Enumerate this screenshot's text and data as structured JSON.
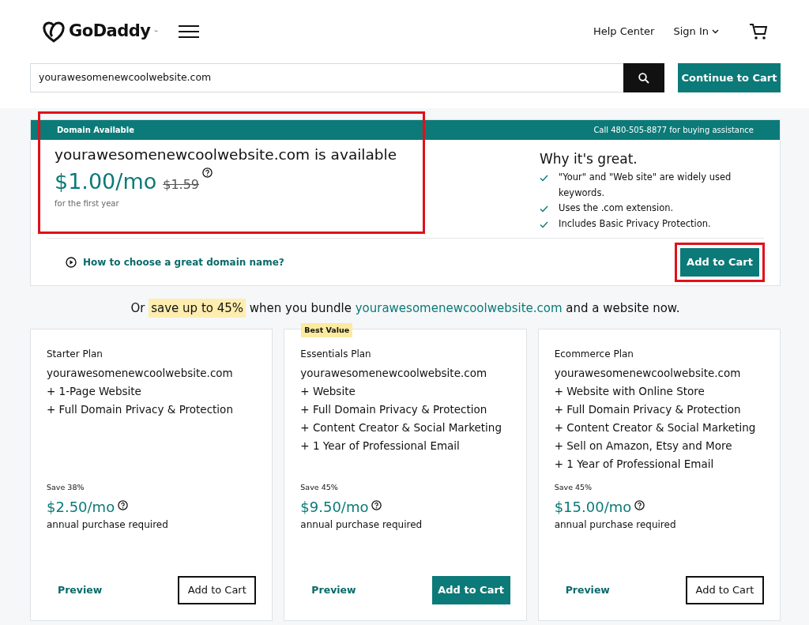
{
  "header": {
    "logo_text": "GoDaddy",
    "logo_mark": "™",
    "links": [
      "Help Center",
      "Sign In"
    ]
  },
  "search": {
    "value": "yourawesomenewcoolwebsite.com",
    "button": "Continue to Cart"
  },
  "domain_card": {
    "banner_left": "Domain Available",
    "banner_right": "Call 480-505-8877 for buying assistance",
    "title": "yourawesomenewcoolwebsite.com is available",
    "price": "$1.00/mo",
    "old_price": "$1.59",
    "price_note": "for the first year",
    "highlighted": true,
    "why_title": "Why it's great.",
    "reasons": [
      "\"Your\" and \"Web site\" are widely used keywords.",
      "Uses the .com extension.",
      "Includes Basic Privacy Protection."
    ],
    "help_link": "How to choose a great domain name?",
    "button": "Add to Cart",
    "button_highlighted": true
  },
  "bundle": {
    "before": "Or",
    "highlight": "save up to 45%",
    "middle": "when you bundle",
    "domain": "yourawesomenewcoolwebsite.com",
    "after": "and a website now."
  },
  "plans": [
    {
      "name": "Starter Plan",
      "domain": "yourawesomenewcoolwebsite.com",
      "features": [
        "+ 1-Page Website",
        "+ Full Domain Privacy & Protection"
      ],
      "save": "Save 38%",
      "price": "$2.50/mo",
      "note": "annual purchase required",
      "preview": "Preview",
      "button": "Add to Cart",
      "primary": false
    },
    {
      "badge": "Best Value",
      "name": "Essentials Plan",
      "domain": "yourawesomenewcoolwebsite.com",
      "features": [
        "+ Website",
        "+ Full Domain Privacy & Protection",
        "+ Content Creator & Social Marketing",
        "+ 1 Year of Professional Email"
      ],
      "save": "Save 45%",
      "price": "$9.50/mo",
      "note": "annual purchase required",
      "preview": "Preview",
      "button": "Add to Cart",
      "primary": true
    },
    {
      "name": "Ecommerce Plan",
      "domain": "yourawesomenewcoolwebsite.com",
      "features": [
        "+ Website with Online Store",
        "+ Full Domain Privacy & Protection",
        "+ Content Creator & Social Marketing",
        "+ Sell on Amazon, Etsy and More",
        "+ 1 Year of Professional Email"
      ],
      "save": "Save 45%",
      "price": "$15.00/mo",
      "note": "annual purchase required",
      "preview": "Preview",
      "button": "Add to Cart",
      "primary": false
    }
  ]
}
